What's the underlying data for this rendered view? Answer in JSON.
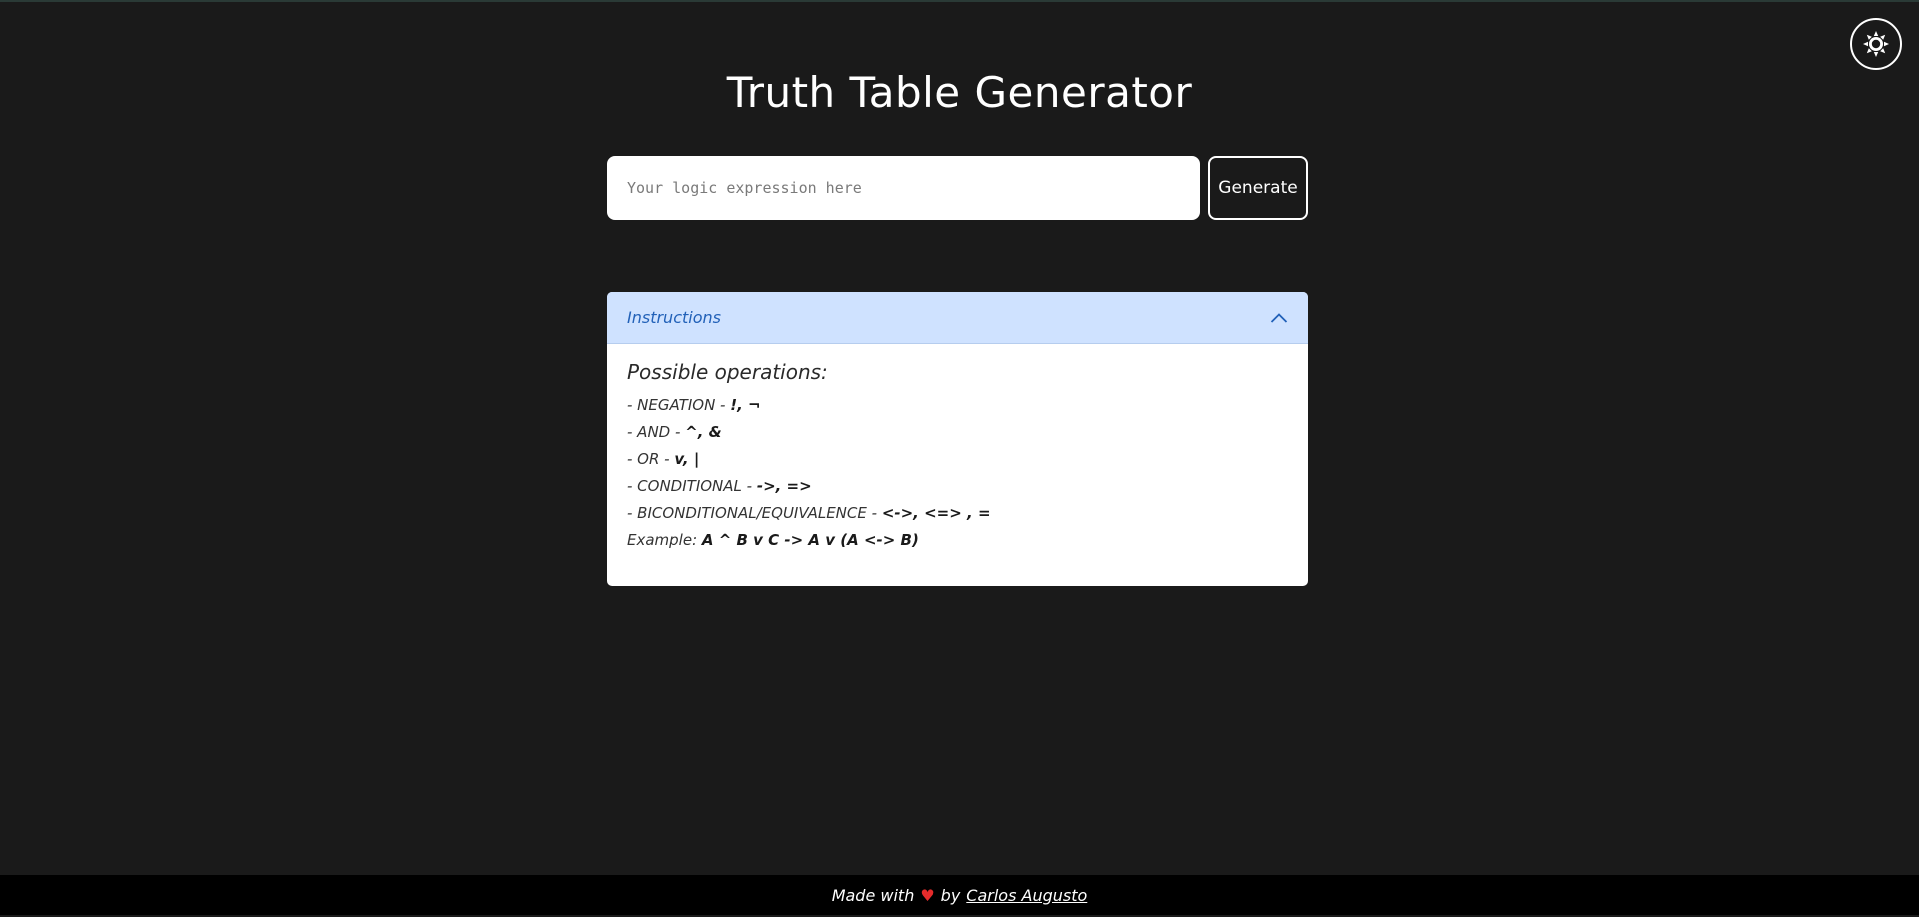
{
  "app": {
    "title": "Truth Table Generator"
  },
  "theme_toggle": {
    "icon": "sun-icon"
  },
  "search": {
    "placeholder": "Your logic expression here",
    "value": "",
    "button_label": "Generate"
  },
  "instructions": {
    "header_label": "Instructions",
    "expanded": true,
    "heading": "Possible operations:",
    "operations": [
      {
        "prefix": "- NEGATION - ",
        "symbols": "!, ¬"
      },
      {
        "prefix": "- AND - ",
        "symbols": "^, &"
      },
      {
        "prefix": "- OR - ",
        "symbols": "v, |"
      },
      {
        "prefix": "- CONDITIONAL - ",
        "symbols": "->, =>"
      },
      {
        "prefix": "- BICONDITIONAL/EQUIVALENCE - ",
        "symbols": "<->, <=> , ="
      }
    ],
    "example_prefix": "Example: ",
    "example_expression": "A ^ B v C -> A v (A <-> B)"
  },
  "footer": {
    "made_with": "Made with",
    "heart": "♥",
    "by": "by",
    "author": "Carlos Augusto"
  },
  "colors": {
    "background": "#1a1a1a",
    "accordion_header_bg": "#cfe2ff",
    "accordion_header_text": "#2261b8",
    "heart": "#e52b2b",
    "footer_bg": "#000000"
  }
}
